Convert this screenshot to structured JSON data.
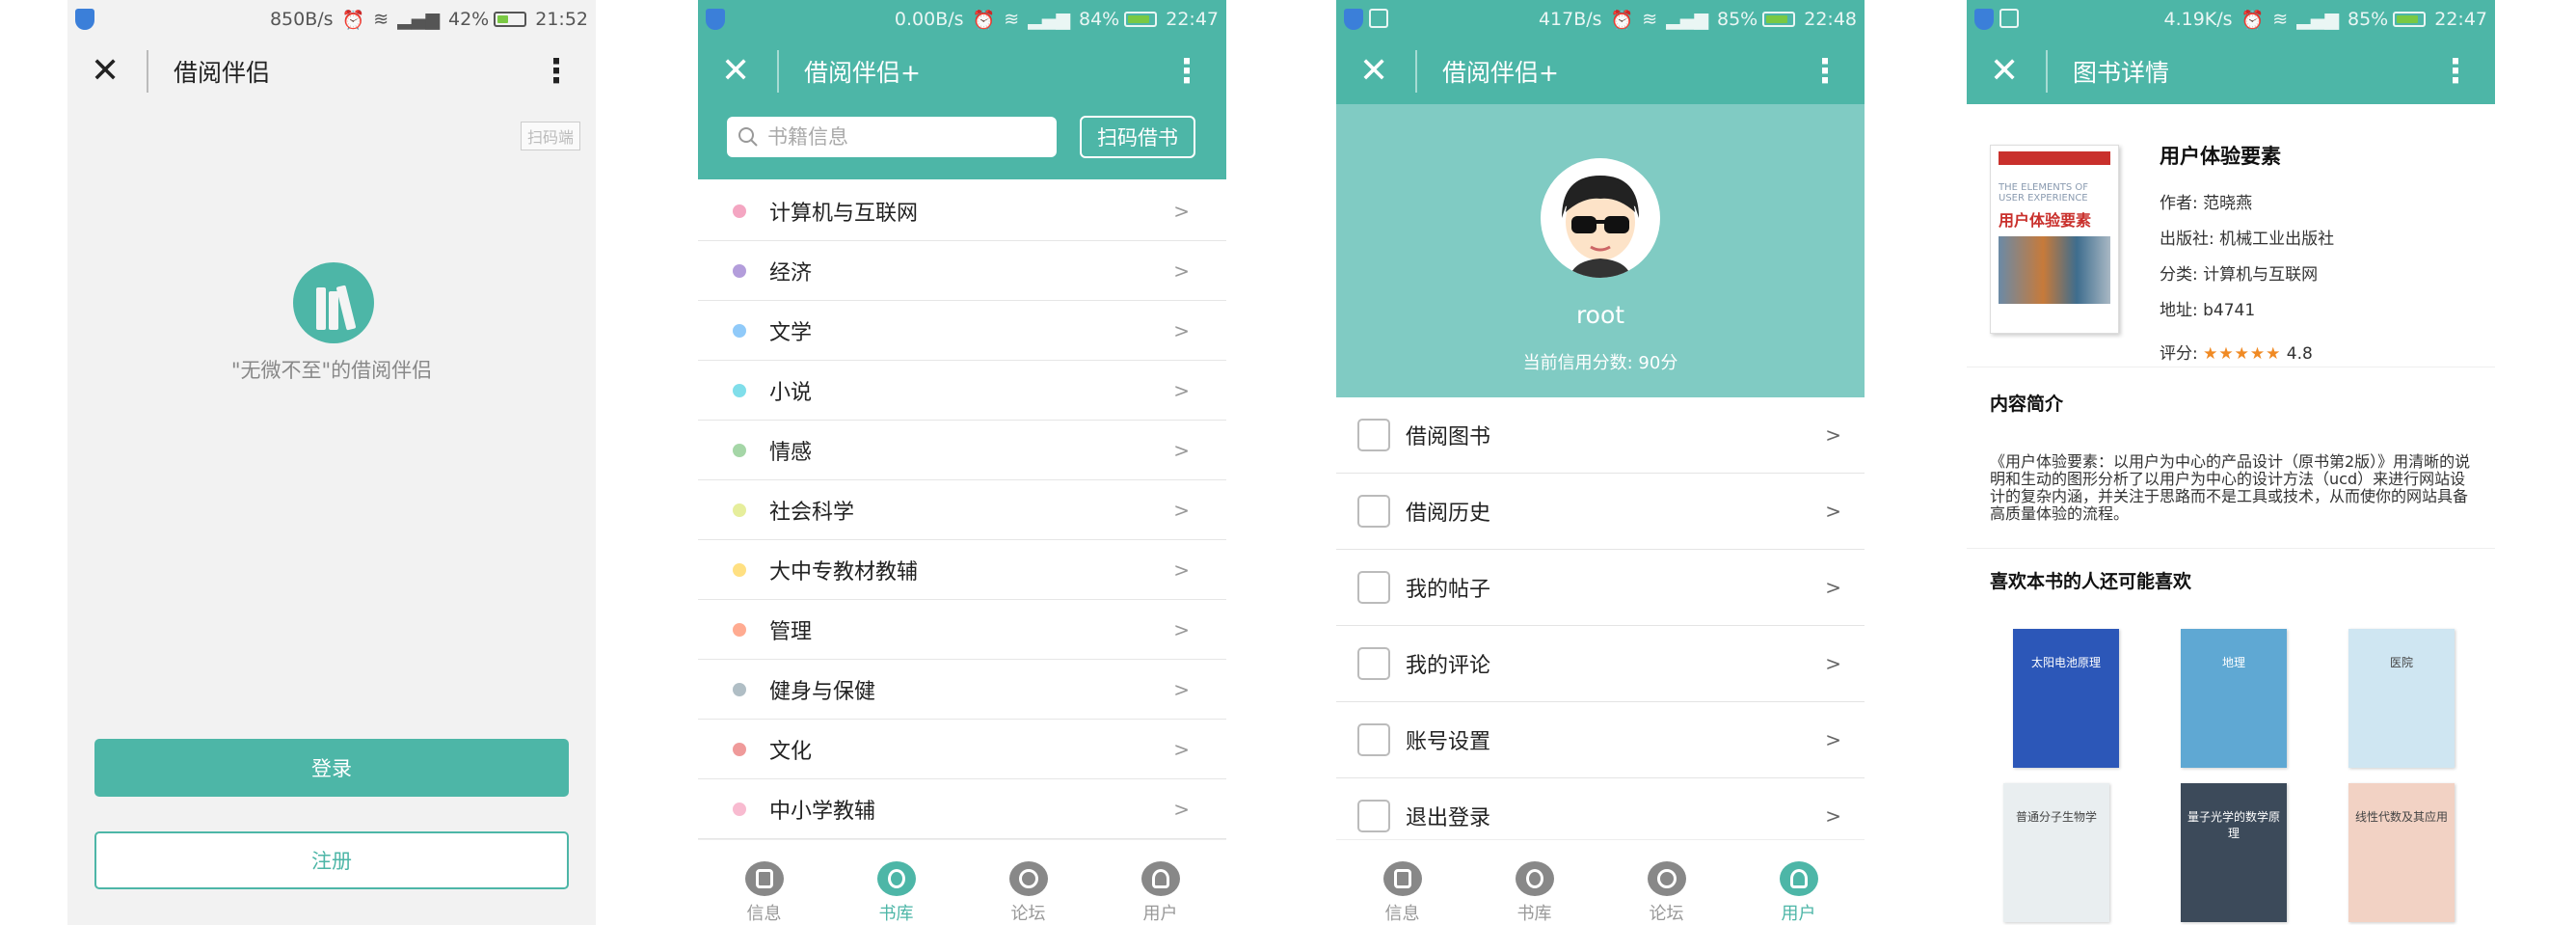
{
  "screen1": {
    "status": {
      "speed": "850B/s",
      "battery": "42%",
      "time": "21:52"
    },
    "title": "借阅伴侣",
    "scan_badge": "扫码端",
    "slogan": "\"无微不至\"的借阅伴侣",
    "login": "登录",
    "register": "注册"
  },
  "screen2": {
    "status": {
      "speed": "0.00B/s",
      "battery": "84%",
      "time": "22:47"
    },
    "title": "借阅伴侣+",
    "search_placeholder": "书籍信息",
    "scan_button": "扫码借书",
    "categories": [
      {
        "label": "计算机与互联网",
        "color": "#f4a6c2"
      },
      {
        "label": "经济",
        "color": "#b39ddb"
      },
      {
        "label": "文学",
        "color": "#90caf9"
      },
      {
        "label": "小说",
        "color": "#80deea"
      },
      {
        "label": "情感",
        "color": "#a5d6a7"
      },
      {
        "label": "社会科学",
        "color": "#e6ee9c"
      },
      {
        "label": "大中专教材教辅",
        "color": "#ffe082"
      },
      {
        "label": "管理",
        "color": "#ffab91"
      },
      {
        "label": "健身与保健",
        "color": "#b0bec5"
      },
      {
        "label": "文化",
        "color": "#ef9a9a"
      },
      {
        "label": "中小学教辅",
        "color": "#f8bbd0"
      }
    ],
    "arrow": ">"
  },
  "screen3": {
    "status": {
      "speed": "417B/s",
      "battery": "85%",
      "time": "22:48"
    },
    "title": "借阅伴侣+",
    "username": "root",
    "credit": "当前信用分数: 90分",
    "menu": [
      {
        "label": "借阅图书",
        "icon": "book-icon"
      },
      {
        "label": "借阅历史",
        "icon": "eye-icon"
      },
      {
        "label": "我的帖子",
        "icon": "list-icon"
      },
      {
        "label": "我的评论",
        "icon": "comment-icon"
      },
      {
        "label": "账号设置",
        "icon": "gear-icon"
      },
      {
        "label": "退出登录",
        "icon": "arrow-left-icon"
      }
    ],
    "arrow": ">"
  },
  "screen4": {
    "status": {
      "speed": "4.19K/s",
      "battery": "85%",
      "time": "22:47"
    },
    "title": "图书详情",
    "book": {
      "title": "用户体验要素",
      "author": "作者: 范晓燕",
      "publisher": "出版社: 机械工业出版社",
      "category": "分类: 计算机与互联网",
      "address": "地址: b4741",
      "rating_label": "评分:",
      "stars": "★★★★★",
      "rating": "4.8",
      "cover_en": "THE ELEMENTS OF USER EXPERIENCE",
      "cover_cn": "用户体验要素"
    },
    "intro_title": "内容简介",
    "intro": "《用户体验要素：以用户为中心的产品设计（原书第2版）》用清晰的说明和生动的图形分析了以用户为中心的设计方法（ucd）来进行网站设计的复杂内涵，并关注于思路而不是工具或技术，从而使你的网站具备高质量体验的流程。",
    "rec_title": "喜欢本书的人还可能喜欢",
    "rec_covers": [
      {
        "title": "太阳电池原理",
        "color": "#2c57b8"
      },
      {
        "title": "地理",
        "color": "#5fa8d3"
      },
      {
        "title": "医院",
        "color": "#cfe6f2"
      },
      {
        "title": "普通分子生物学",
        "color": "#e9eef0"
      },
      {
        "title": "量子光学的数学原理",
        "color": "#3c4a5a"
      },
      {
        "title": "线性代数及其应用",
        "color": "#f2d2c4"
      }
    ]
  },
  "tabs": [
    "信息",
    "书库",
    "论坛",
    "用户"
  ],
  "colors": {
    "accent": "#4db6a7",
    "header_light": "#80cbc3"
  }
}
